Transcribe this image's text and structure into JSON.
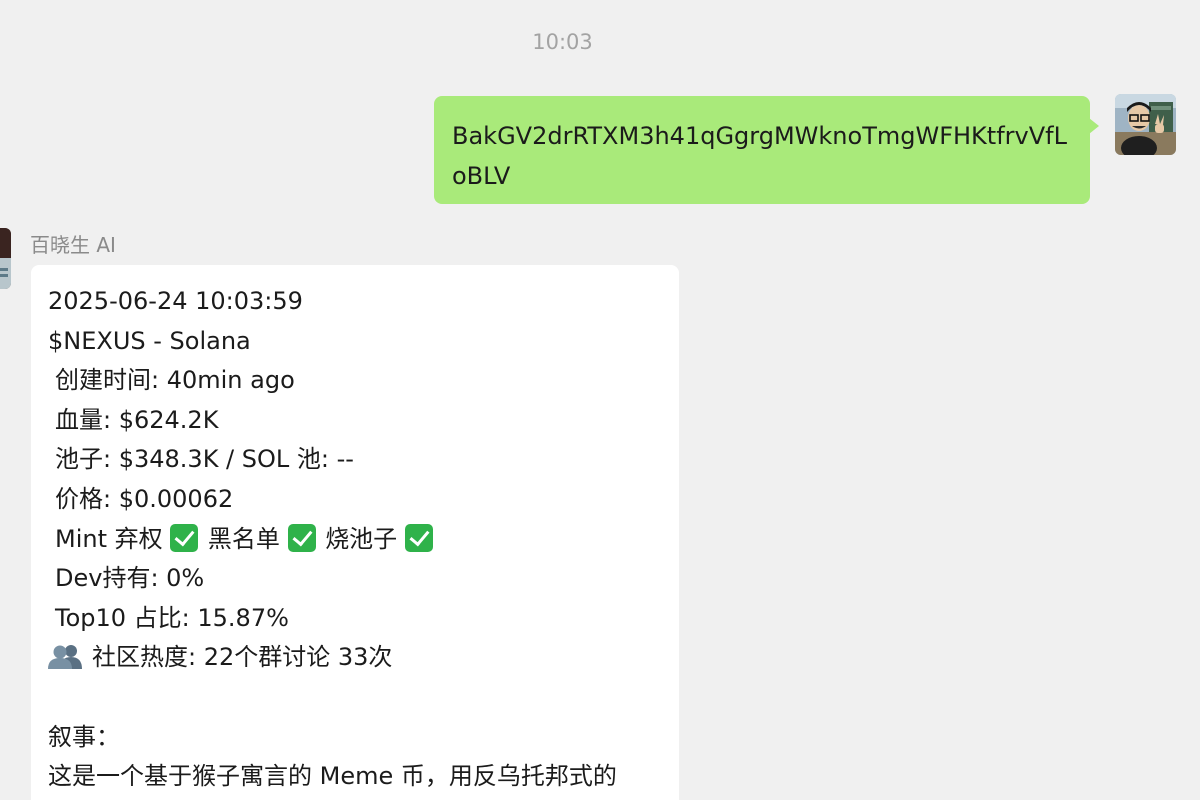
{
  "timestamp": "10:03",
  "outgoing": {
    "text": "BakGV2drRTXM3h41qGgrgMWknoTmgWFHKtfrvVfLoBLV"
  },
  "incoming": {
    "sender": "百晓生 AI",
    "lines": {
      "datetime": "2025-06-24 10:03:59",
      "token": "$NEXUS - Solana",
      "created": "创建时间: 40min ago",
      "blood": "血量: $624.2K",
      "pool": "池子: $348.3K / SOL 池: --",
      "price": "价格: $0.00062",
      "mint_label": "Mint 弃权",
      "blacklist_label": "黑名单",
      "burn_label": "烧池子",
      "dev": "Dev持有: 0%",
      "top10": "Top10 占比: 15.87%",
      "community": "社区热度: 22个群讨论 33次",
      "narrative_title": "叙事：",
      "narrative": "这是一个基于猴子寓言的 Meme 币，用反乌托邦式的"
    }
  },
  "colors": {
    "background": "#f0f0f0",
    "outgoing_bubble": "#a9ea7a",
    "incoming_bubble": "#ffffff",
    "check": "#2fb24a"
  },
  "icons": {
    "check": "check-mark-button-icon",
    "community": "busts-in-silhouette-icon"
  }
}
